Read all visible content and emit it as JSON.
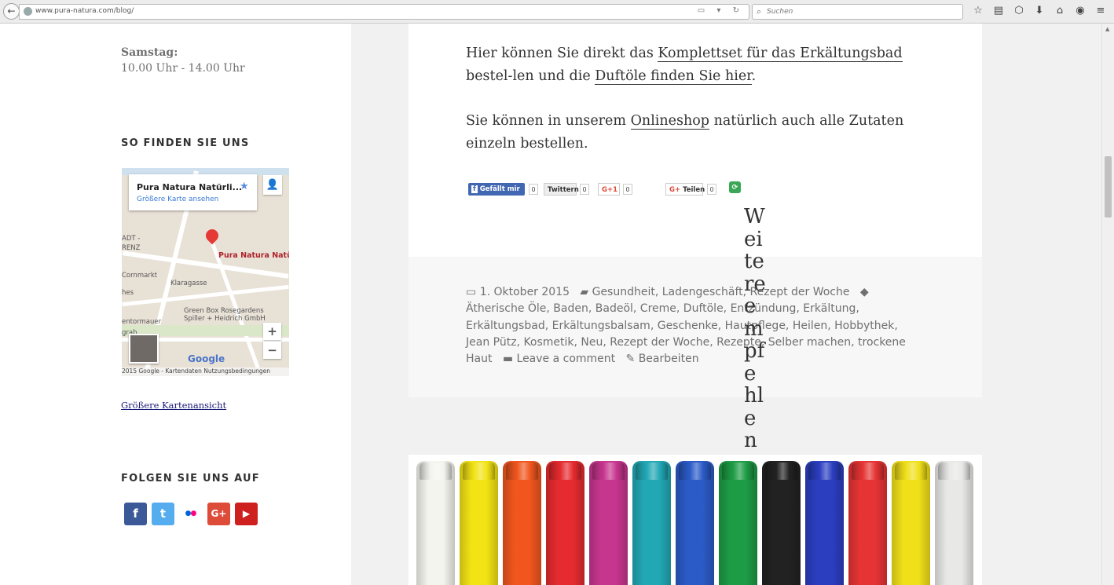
{
  "browser": {
    "url": "www.pura-natura.com/blog/",
    "search_placeholder": "Suchen",
    "url_icons": "▭ ▾ ↻",
    "toolbar_icons": [
      "☆",
      "▤",
      "⬡",
      "⬇",
      "⌂",
      "◉",
      "≡"
    ]
  },
  "sidebar": {
    "hours_label": "Samstag:",
    "hours_value": "10.00 Uhr - 14.00 Uhr",
    "find_title": "SO FINDEN SIE UNS",
    "map": {
      "card_title": "Pura Natura Natürli...",
      "card_link": "Größere Karte ansehen",
      "pin_label": "Pura Natura Natürl",
      "labels": [
        "ADT -",
        "RENZ",
        "Cornmarkt",
        "Klaragasse",
        "hes",
        "Green Box Rosegardens",
        "Spiller + Heidrich GmbH",
        "entormauer",
        "grab"
      ],
      "google": "Google",
      "footer": "2015 Google - Kartendaten     Nutzungsbedingungen"
    },
    "map_link": "Größere Kartenansicht",
    "follow_title": "FOLGEN SIE UNS AUF",
    "social": [
      {
        "name": "facebook",
        "glyph": "f",
        "color": "#3b5998"
      },
      {
        "name": "twitter",
        "glyph": "t",
        "color": "#55acee"
      },
      {
        "name": "flickr",
        "glyph": "●●",
        "color": "#ffffff"
      },
      {
        "name": "googleplus",
        "glyph": "G+",
        "color": "#dd4b39"
      },
      {
        "name": "youtube",
        "glyph": "▶",
        "color": "#cd201f"
      }
    ]
  },
  "article": {
    "p1_pre": "Hier können Sie direkt das ",
    "p1_link1": "Komplettset für das Erkältungsbad",
    "p1_mid": " bestel-len und die ",
    "p1_link2": "Duftöle finden Sie hier",
    "p1_post": ".",
    "p2_pre": "Sie können in unserem ",
    "p2_link": "Onlineshop",
    "p2_post": " natürlich auch alle Zutaten einzeln bestellen.",
    "share": {
      "fb_label": "Gefällt mir",
      "fb_count": "0",
      "twitter_label": "Twittern",
      "twitter_count": "0",
      "gplus_label": "G+1",
      "gplus_count": "0",
      "gshare_label": "Teilen",
      "gshare_count": "0"
    },
    "meta": {
      "date": "1. Oktober 2015",
      "categories": "Gesundheit, Ladengeschäft, Rezept der Woche",
      "tags": "Ätherische Öle, Baden, Badeöl, Creme, Duftöle, Entzündung, Erkältung, Erkältungsbad, Erkältungsbalsam, Geschenke, Hautpflege, Heilen, Hobbythek, Jean Pütz, Kosmetik, Neu, Rezept der Woche, Rezepte, Selber machen, trockene Haut",
      "comment": "Leave a comment",
      "edit": "Bearbeiten"
    },
    "related": "Weitere empfehlen"
  },
  "tube_colors": [
    "#f4f4ee",
    "#f2e315",
    "#f0561e",
    "#e52b2f",
    "#c7368e",
    "#22a8b5",
    "#2b5bc7",
    "#1e9c45",
    "#222222",
    "#2b3ec0",
    "#e63434",
    "#f0e01a",
    "#e8e8e6"
  ]
}
